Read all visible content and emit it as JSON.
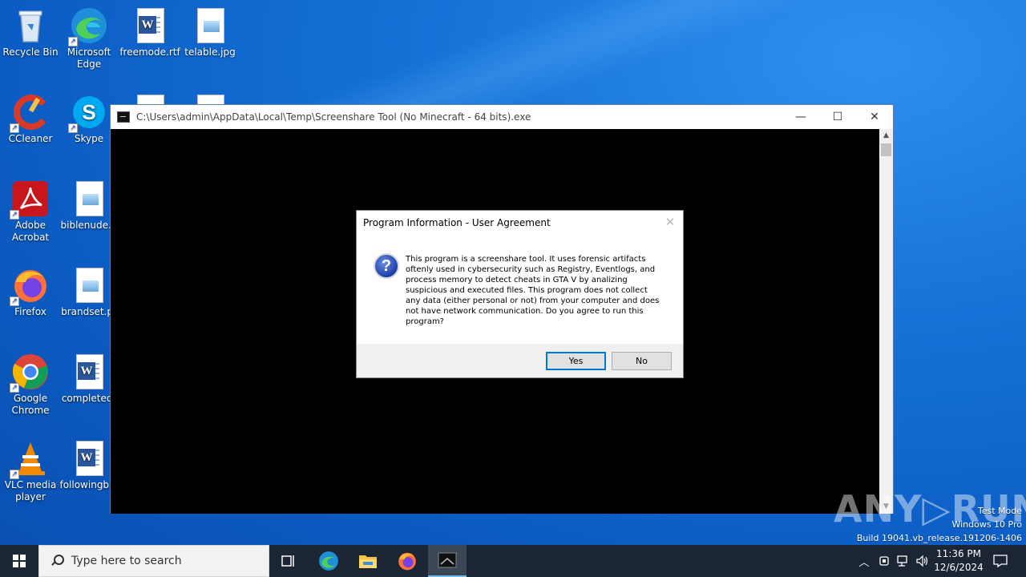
{
  "desktop": {
    "icons": [
      {
        "label": "Recycle Bin",
        "icon": "recycle-bin-icon"
      },
      {
        "label": "Microsoft Edge",
        "icon": "edge-icon"
      },
      {
        "label": "freemode.rtf",
        "icon": "word-doc-icon"
      },
      {
        "label": "telable.jpg",
        "icon": "image-file-icon"
      },
      {
        "label": "CCleaner",
        "icon": "ccleaner-icon"
      },
      {
        "label": "Skype",
        "icon": "skype-icon"
      },
      {
        "label": "Adobe Acrobat",
        "icon": "acrobat-icon"
      },
      {
        "label": "biblenude...",
        "icon": "image-file-icon"
      },
      {
        "label": "Firefox",
        "icon": "firefox-icon"
      },
      {
        "label": "brandset.pr",
        "icon": "image-file-icon"
      },
      {
        "label": "Google Chrome",
        "icon": "chrome-icon"
      },
      {
        "label": "completedt",
        "icon": "word-doc-icon"
      },
      {
        "label": "VLC media player",
        "icon": "vlc-icon"
      },
      {
        "label": "followingb...",
        "icon": "word-doc-icon"
      }
    ]
  },
  "console_window": {
    "title": "C:\\Users\\admin\\AppData\\Local\\Temp\\Screenshare Tool (No Minecraft - 64 bits).exe",
    "minimize": "—",
    "maximize": "☐",
    "close": "✕"
  },
  "dialog": {
    "title": "Program Information - User Agreement",
    "close": "✕",
    "icon": "question-icon",
    "message": "This program is a screenshare tool. It uses forensic artifacts oftenly used in cybersecurity such as Registry, Eventlogs, and process memory to detect cheats in GTA V by analizing suspicious and executed files. This program does not collect any data (either personal or not) from your computer and does not have network communication. Do you agree to run this program?",
    "yes_label": "Yes",
    "no_label": "No"
  },
  "watermark": {
    "brand": "ANY▷RUN",
    "mode": "Test Mode",
    "edition": "Windows 10 Pro",
    "build": "Build 19041.vb_release.191206-1406"
  },
  "taskbar": {
    "search_placeholder": "Type here to search",
    "time": "11:36 PM",
    "date": "12/6/2024"
  },
  "colors": {
    "desktop": "#0b5cc4",
    "taskbar": "#1b2533",
    "accent": "#0078d7"
  }
}
